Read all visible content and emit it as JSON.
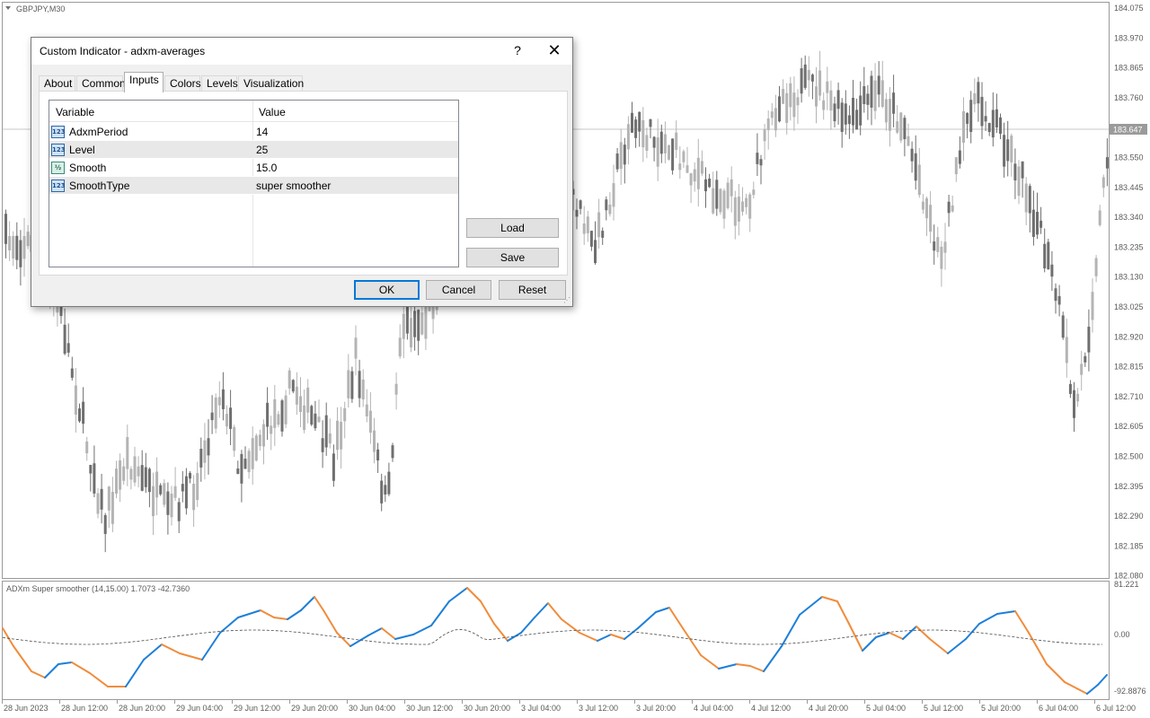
{
  "chart": {
    "symbol_label": "GBPJPY,M30",
    "symbol_triangle_icon": "triangle-down-icon",
    "current_price_label": "183.647",
    "price_axis": [
      "184.075",
      "183.970",
      "183.865",
      "183.760",
      "183.655",
      "183.550",
      "183.445",
      "183.340",
      "183.235",
      "183.130",
      "183.025",
      "182.920",
      "182.815",
      "182.710",
      "182.605",
      "182.500",
      "182.395",
      "182.290",
      "182.185",
      "182.080"
    ],
    "indicator_label": "ADXm Super smoother (14,15.00) 1.7073 -42.7360",
    "indicator_axis": [
      "81.221",
      "0.00",
      "-92.8876"
    ],
    "time_axis": [
      "28 Jun 2023",
      "28 Jun 12:00",
      "28 Jun 20:00",
      "29 Jun 04:00",
      "29 Jun 12:00",
      "29 Jun 20:00",
      "30 Jun 04:00",
      "30 Jun 12:00",
      "30 Jun 20:00",
      "3 Jul 04:00",
      "3 Jul 12:00",
      "3 Jul 20:00",
      "4 Jul 04:00",
      "4 Jul 12:00",
      "4 Jul 20:00",
      "5 Jul 04:00",
      "5 Jul 12:00",
      "5 Jul 20:00",
      "6 Jul 04:00",
      "6 Jul 12:00"
    ],
    "colors": {
      "candle_up": "#b4b4b4",
      "candle_down": "#6f6f6f",
      "line_blue": "#1e7fd8",
      "line_orange": "#f08c3c",
      "signal_line": "#4a4a4a",
      "axis_text": "#5a5a5a",
      "grid_border": "#9a9a9a"
    }
  },
  "dialog": {
    "title": "Custom Indicator - adxm-averages",
    "help_icon": "?",
    "close_icon": "✕",
    "tabs": [
      "About",
      "Common",
      "Inputs",
      "Colors",
      "Levels",
      "Visualization"
    ],
    "active_tab": "Inputs",
    "table": {
      "header_variable": "Variable",
      "header_value": "Value",
      "rows": [
        {
          "icon": "123",
          "name": "AdxmPeriod",
          "value": "14"
        },
        {
          "icon": "123",
          "name": "Level",
          "value": "25"
        },
        {
          "icon": "½",
          "name": "Smooth",
          "value": "15.0"
        },
        {
          "icon": "123",
          "name": "SmoothType",
          "value": "super smoother"
        }
      ]
    },
    "buttons": {
      "load": "Load",
      "save": "Save",
      "ok": "OK",
      "cancel": "Cancel",
      "reset": "Reset"
    }
  }
}
